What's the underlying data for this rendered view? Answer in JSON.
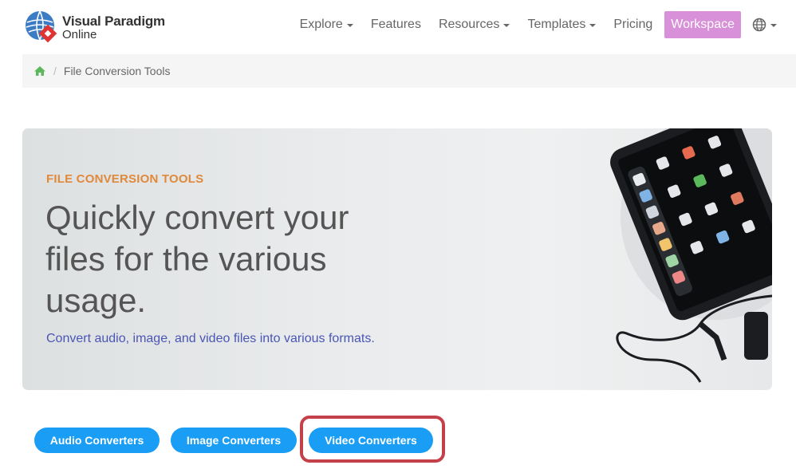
{
  "brand": {
    "name_line1": "Visual Paradigm",
    "name_line2": "Online",
    "icon": "visual-paradigm-logo-icon"
  },
  "nav": {
    "explore": "Explore",
    "features": "Features",
    "resources": "Resources",
    "templates": "Templates",
    "pricing": "Pricing",
    "workspace": "Workspace",
    "language_icon": "globe-icon",
    "accent": "#d890d8"
  },
  "breadcrumb": {
    "home_icon": "home-icon",
    "current": "File Conversion Tools"
  },
  "hero": {
    "tag": "FILE CONVERSION TOOLS",
    "title": "Quickly convert your files for the various usage.",
    "subtitle": "Convert audio, image, and video files into various formats.",
    "tag_color": "#e0893a",
    "subtitle_color": "#4a56b5"
  },
  "converters": {
    "audio": "Audio Converters",
    "image": "Image Converters",
    "video": "Video Converters",
    "button_color": "#1a9ef5",
    "highlight_color": "#c5414a"
  }
}
